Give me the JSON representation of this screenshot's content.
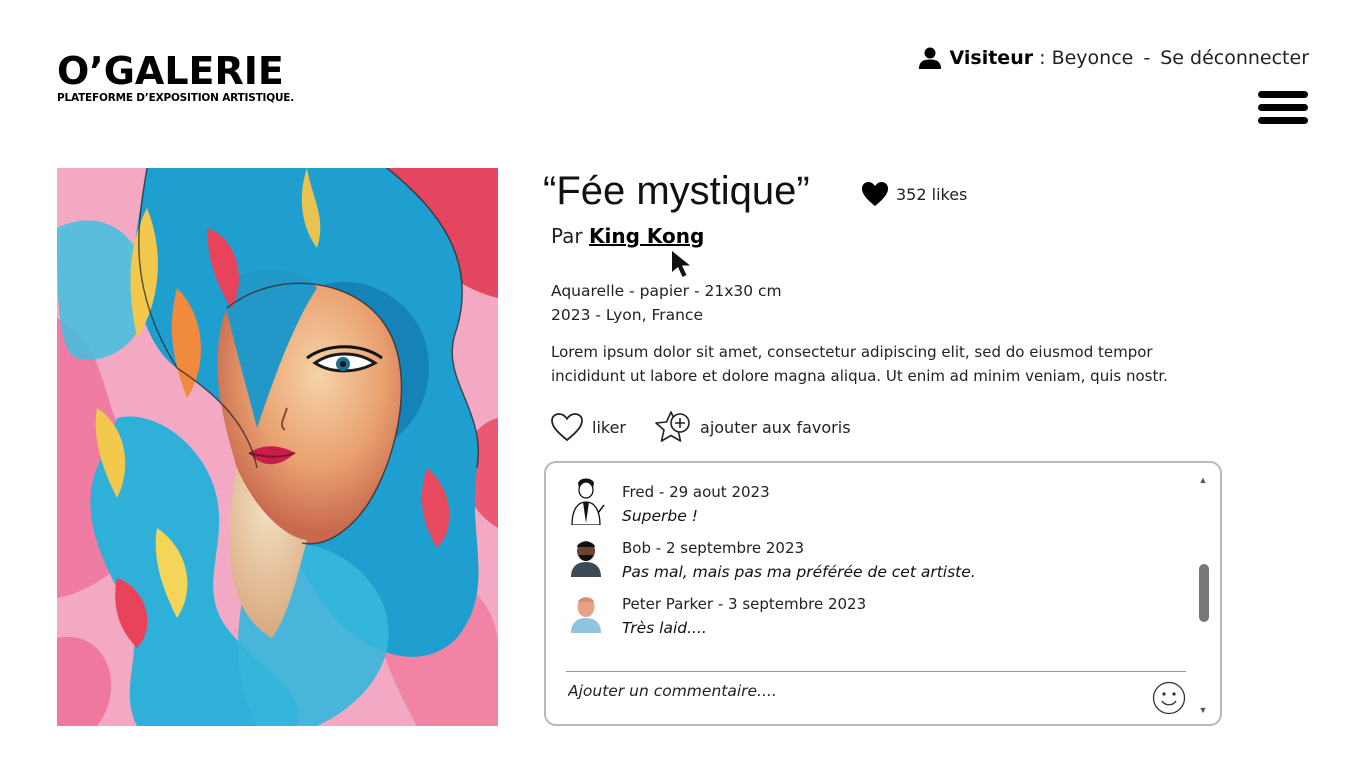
{
  "brand": {
    "title": "O’GALERIE",
    "subtitle": "PLATEFORME D’EXPOSITION ARTISTIQUE."
  },
  "user": {
    "icon": "user-icon",
    "role": "Visiteur",
    "separator": " : ",
    "name": "Beyonce",
    "dash": "-",
    "logout": "Se déconnecter"
  },
  "menu": {
    "icon": "hamburger-menu-icon"
  },
  "artwork": {
    "title": "“Fée mystique”",
    "likes": "352 likes",
    "by_prefix": "Par ",
    "artist": "King Kong",
    "medium": "Aquarelle - papier - 21x30 cm",
    "year_place": "2023 - Lyon, France",
    "description": "Lorem ipsum dolor sit amet, consectetur adipiscing elit, sed do eiusmod tempor incididunt ut labore et dolore magna aliqua. Ut enim ad minim veniam, quis nostr."
  },
  "actions": {
    "like_label": "liker",
    "favorite_label": "ajouter aux favoris"
  },
  "comments": {
    "items": [
      {
        "author_date": "Fred - 29 aout 2023",
        "text": "Superbe !"
      },
      {
        "author_date": "Bob - 2 septembre 2023",
        "text": "Pas mal, mais pas ma préférée de cet artiste."
      },
      {
        "author_date": "Peter Parker - 3 septembre 2023",
        "text": "Très laid...."
      }
    ],
    "placeholder": "Ajouter un commentaire....",
    "scroll_up": "▲",
    "scroll_down": "▼"
  },
  "colors": {
    "accent": "#000000",
    "border": "#b9b9b9"
  }
}
